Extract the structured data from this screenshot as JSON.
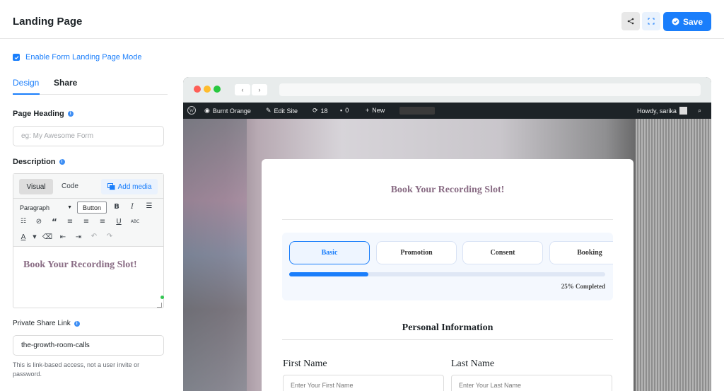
{
  "header": {
    "title": "Landing Page",
    "save_label": "Save"
  },
  "enable_mode": {
    "label": "Enable Form Landing Page Mode",
    "checked": true
  },
  "tabs": [
    {
      "label": "Design",
      "active": true
    },
    {
      "label": "Share",
      "active": false
    }
  ],
  "page_heading": {
    "label": "Page Heading",
    "placeholder": "eg: My Awesome Form",
    "value": ""
  },
  "description": {
    "label": "Description",
    "editor_tabs": {
      "visual": "Visual",
      "code": "Code",
      "add_media": "Add media"
    },
    "format": "Paragraph",
    "button_label": "Button",
    "content": "Book Your Recording Slot!"
  },
  "share_link": {
    "label": "Private Share Link",
    "value": "the-growth-room-calls",
    "help": "This is link-based access, not a user invite or password."
  },
  "preview": {
    "wp_bar": {
      "site": "Burnt Orange",
      "edit": "Edit Site",
      "updates": "18",
      "comments": "0",
      "new": "New",
      "howdy": "Howdy, sarika"
    },
    "form": {
      "title": "Book Your Recording Slot!",
      "steps": [
        {
          "label": "Basic",
          "active": true
        },
        {
          "label": "Promotion",
          "active": false
        },
        {
          "label": "Consent",
          "active": false
        },
        {
          "label": "Booking",
          "active": false
        }
      ],
      "progress_percent": 25,
      "progress_text": "25% Completed",
      "section_title": "Personal Information",
      "first_name": {
        "label": "First Name",
        "placeholder": "Enter Your First Name"
      },
      "last_name": {
        "label": "Last Name",
        "placeholder": "Enter Your Last Name"
      }
    }
  },
  "colors": {
    "accent": "#1a7efb",
    "heading_purple": "#8a6d85"
  }
}
